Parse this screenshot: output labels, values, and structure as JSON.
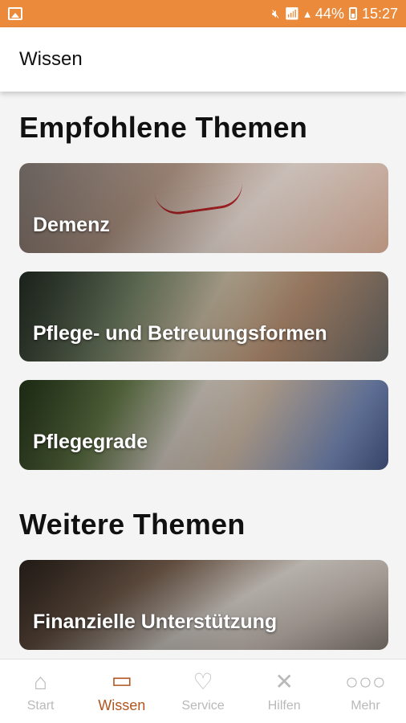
{
  "statusbar": {
    "battery": "44%",
    "time": "15:27",
    "icons": [
      "image-icon",
      "mute-icon",
      "wifi-icon",
      "signal-icon",
      "battery-icon"
    ]
  },
  "appbar": {
    "title": "Wissen"
  },
  "sections": [
    {
      "title": "Empfohlene Themen",
      "cards": [
        "Demenz",
        "Pflege- und Betreuungsformen",
        "Pflegegrade"
      ]
    },
    {
      "title": "Weitere Themen",
      "cards": [
        "Finanzielle Unterstützung"
      ]
    }
  ],
  "nav": {
    "items": [
      {
        "label": "Start",
        "icon": "home-icon"
      },
      {
        "label": "Wissen",
        "icon": "book-icon"
      },
      {
        "label": "Service",
        "icon": "handshake-heart-icon"
      },
      {
        "label": "Hilfen",
        "icon": "tools-icon"
      },
      {
        "label": "Mehr",
        "icon": "more-dots-icon"
      }
    ],
    "active": "Wissen"
  },
  "colors": {
    "statusbar": "#ec8a3c",
    "nav_active": "#b0551f",
    "nav_inactive": "#b9b9b9"
  }
}
